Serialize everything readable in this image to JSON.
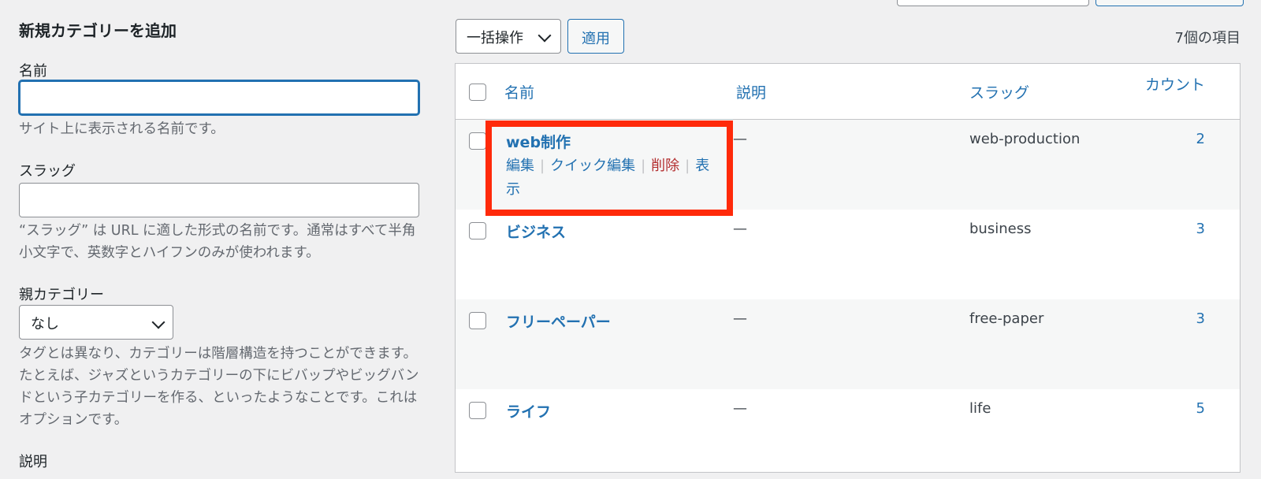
{
  "form": {
    "title": "新規カテゴリーを追加",
    "name_label": "名前",
    "name_value": "",
    "name_help": "サイト上に表示される名前です。",
    "slug_label": "スラッグ",
    "slug_value": "",
    "slug_help": "“スラッグ” は URL に適した形式の名前です。通常はすべて半角小文字で、英数字とハイフンのみが使われます。",
    "parent_label": "親カテゴリー",
    "parent_selected": "なし",
    "parent_help": "タグとは異なり、カテゴリーは階層構造を持つことができます。たとえば、ジャズというカテゴリーの下にビバップやビッグバンドという子カテゴリーを作る、といったようなことです。これはオプションです。",
    "desc_label": "説明"
  },
  "bulk": {
    "select_label": "一括操作",
    "apply_label": "適用",
    "items_count": "7個の項目"
  },
  "table": {
    "headers": {
      "name": "名前",
      "description": "説明",
      "slug": "スラッグ",
      "count": "カウント"
    },
    "rows": [
      {
        "name": "web制作",
        "description": "—",
        "slug": "web-production",
        "count": "2",
        "actions": {
          "edit": "編集",
          "quick_edit": "クイック編集",
          "delete": "削除",
          "view": "表示"
        }
      },
      {
        "name": "ビジネス",
        "description": "—",
        "slug": "business",
        "count": "3"
      },
      {
        "name": "フリーペーパー",
        "description": "—",
        "slug": "free-paper",
        "count": "3"
      },
      {
        "name": "ライフ",
        "description": "—",
        "slug": "life",
        "count": "5"
      }
    ]
  },
  "colors": {
    "accent": "#2271b1",
    "delete": "#b32d2e",
    "highlight": "#ff2a0a"
  }
}
